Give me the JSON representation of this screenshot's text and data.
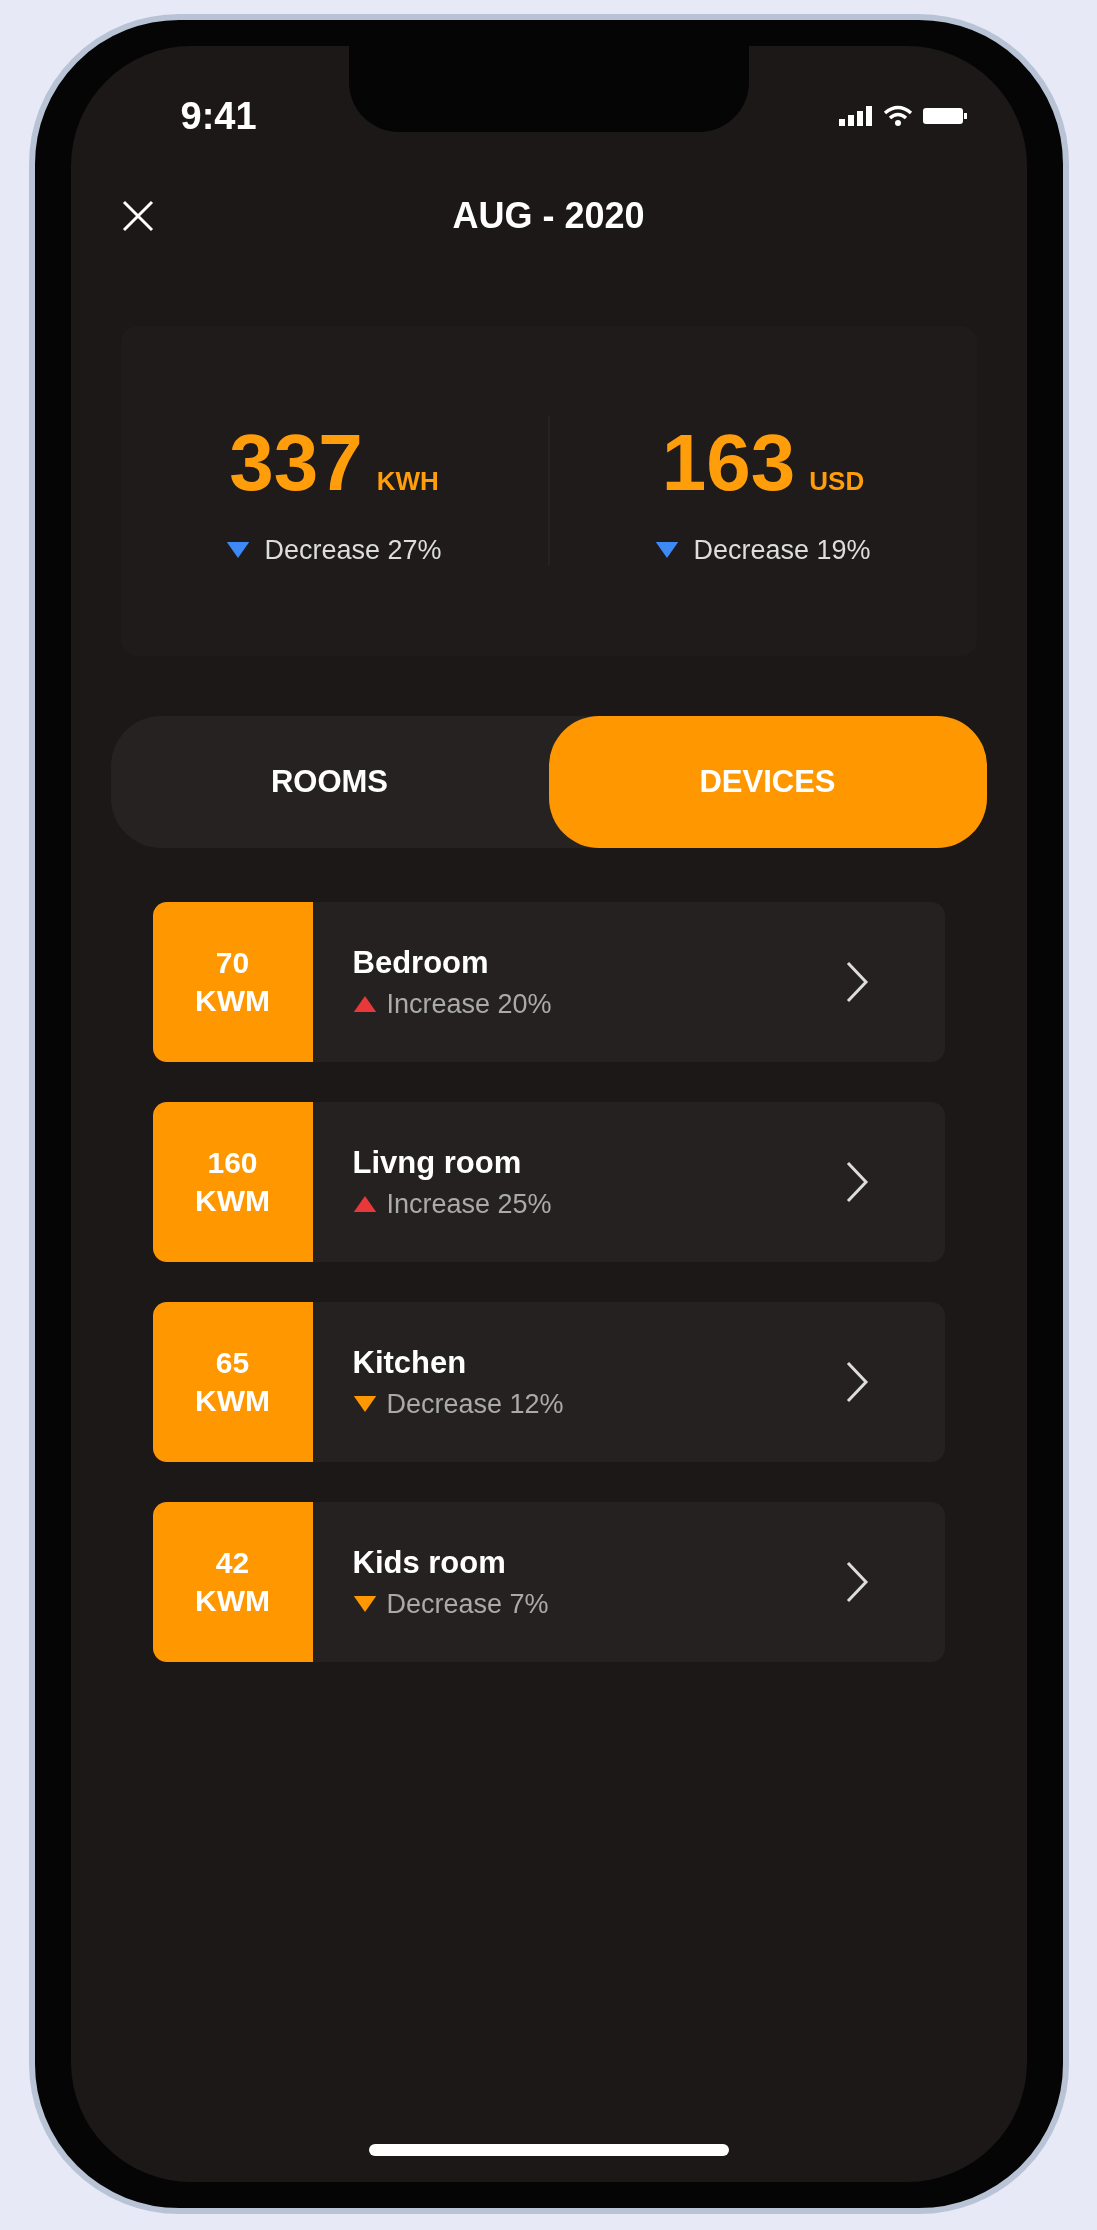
{
  "status_bar": {
    "time": "9:41"
  },
  "header": {
    "title": "AUG - 2020"
  },
  "stats": [
    {
      "value": "337",
      "unit": "KWH",
      "kind": "down",
      "color": "#3d8af7",
      "change": "Decrease 27%"
    },
    {
      "value": "163",
      "unit": "USD",
      "kind": "down",
      "color": "#3d8af7",
      "change": "Decrease 19%"
    }
  ],
  "tabs": [
    {
      "label": "ROOMS",
      "selected": false
    },
    {
      "label": "DEVICES",
      "selected": true
    }
  ],
  "rooms": [
    {
      "amount": "70",
      "unit": "KWM",
      "name": "Bedroom",
      "kind": "up",
      "color": "#e8383a",
      "change": "Increase 20%"
    },
    {
      "amount": "160",
      "unit": "KWM",
      "name": "Livng room",
      "kind": "up",
      "color": "#e8383a",
      "change": "Increase 25%"
    },
    {
      "amount": "65",
      "unit": "KWM",
      "name": "Kitchen",
      "kind": "down",
      "color": "#ff9800",
      "change": "Decrease 12%"
    },
    {
      "amount": "42",
      "unit": "KWM",
      "name": "Kids room",
      "kind": "down",
      "color": "#ff9800",
      "change": "Decrease 7%"
    }
  ]
}
